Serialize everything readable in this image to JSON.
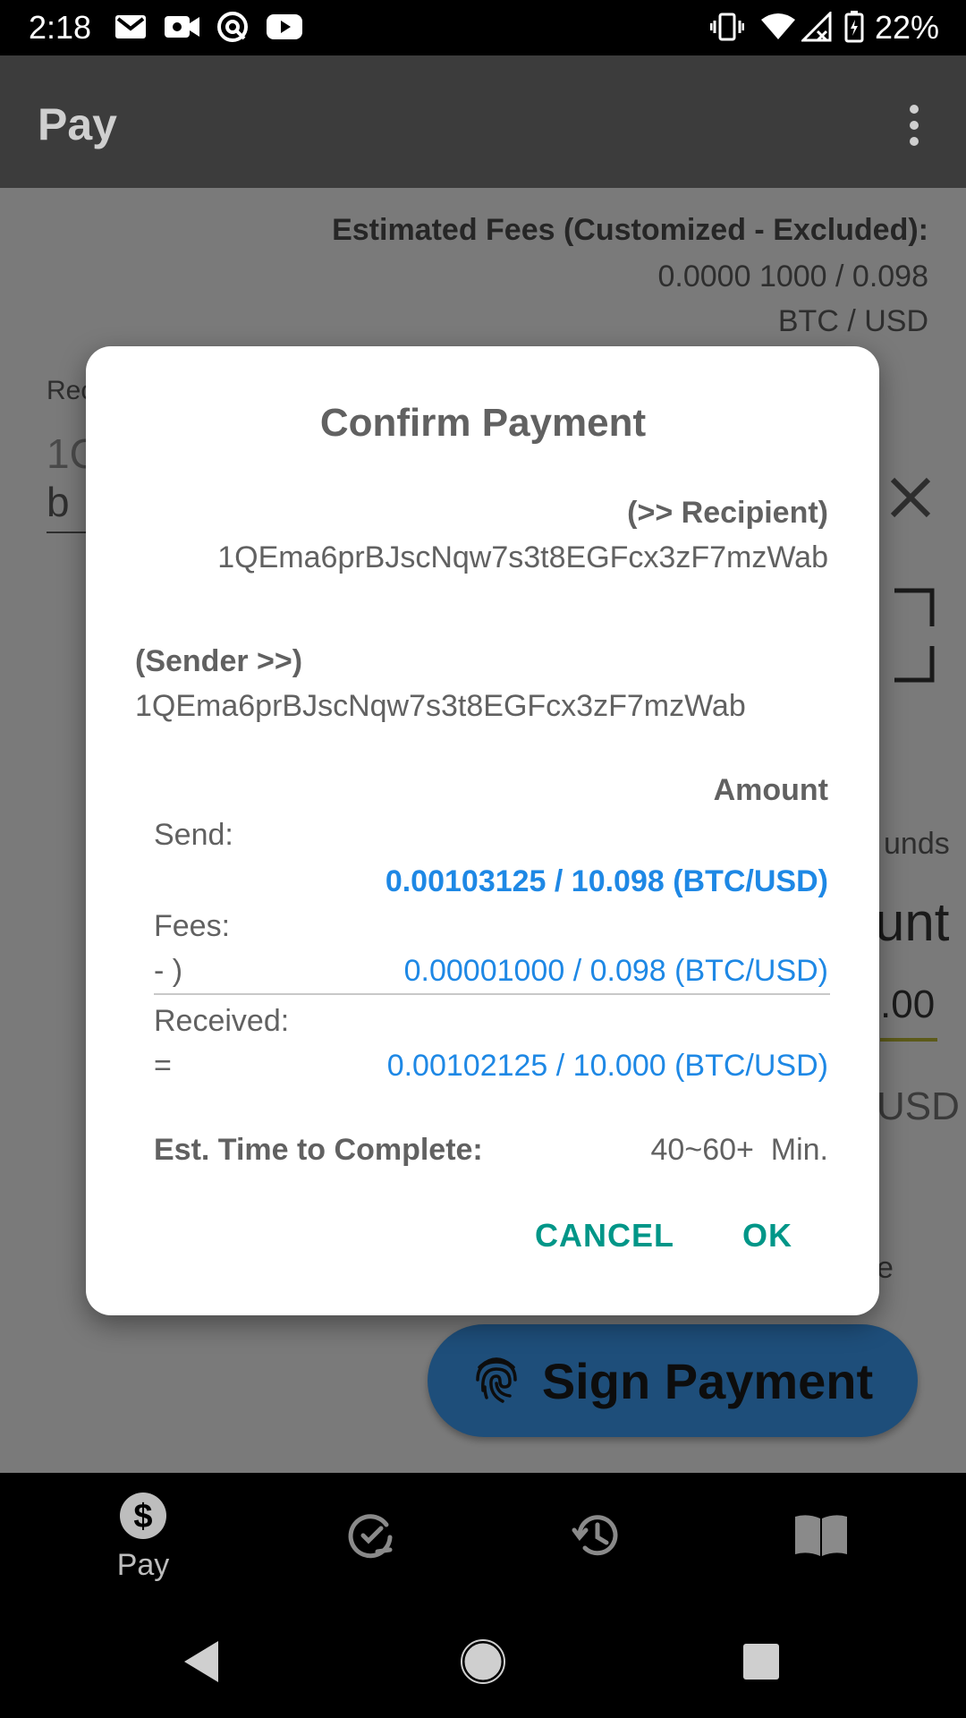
{
  "status_bar": {
    "time": "2:18",
    "battery": "22%",
    "icons": [
      "gmail-icon",
      "video-call-icon",
      "vpn-icon",
      "youtube-icon",
      "vibrate-icon",
      "wifi-icon",
      "signal-icon",
      "battery-icon"
    ]
  },
  "app_bar": {
    "title": "Pay",
    "menu_icon": "more-vert-icon"
  },
  "background": {
    "fees_heading": "Estimated Fees (Customized - Excluded):",
    "fees_value": "0.0000 1000 / 0.098",
    "fees_unit": "BTC / USD",
    "recipient_field_label_fragment": "Rec",
    "recipient_field_value_fragment_1": "1C",
    "recipient_field_value_fragment_2": "b",
    "funds_fragment": "unds",
    "amount_fragment": "unt",
    "amount_value_fragment": ".00",
    "usd_fragment": "USD",
    "e_fragment": "e",
    "sign_payment_label": "Sign Payment"
  },
  "dialog": {
    "title": "Confirm Payment",
    "recipient_label": "(>> Recipient)",
    "recipient_address": "1QEma6prBJscNqw7s3t8EGFcx3zF7mzWab",
    "sender_label": "(Sender >>)",
    "sender_address": "1QEma6prBJscNqw7s3t8EGFcx3zF7mzWab",
    "amount_label": "Amount",
    "send_label": "Send:",
    "send_value": "0.00103125 / 10.098 (BTC/USD)",
    "fees_label": "Fees:",
    "fees_op": "- )",
    "fees_value": "0.00001000 / 0.098 (BTC/USD)",
    "received_label": "Received:",
    "received_op": "=",
    "received_value": "0.00102125 / 10.000 (BTC/USD)",
    "est_time_label": "Est. Time to Complete:",
    "est_time_value": "40~60+  Min.",
    "cancel_label": "CANCEL",
    "ok_label": "OK"
  },
  "bottom_nav": {
    "items": [
      {
        "label": "Pay",
        "icon": "dollar-icon"
      },
      {
        "label": "",
        "icon": "receive-icon"
      },
      {
        "label": "",
        "icon": "history-icon"
      },
      {
        "label": "",
        "icon": "book-icon"
      }
    ]
  },
  "colors": {
    "accent_blue": "#1e88e5",
    "button_teal": "#009688",
    "sign_button": "#1e4e7a"
  }
}
